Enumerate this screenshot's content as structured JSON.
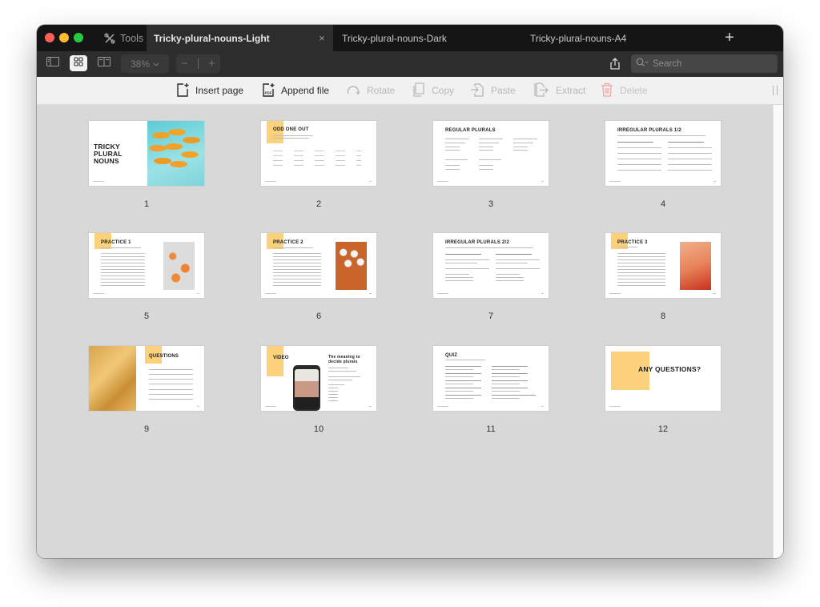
{
  "window": {
    "tools_label": "Tools",
    "tabs": [
      {
        "label": "Tricky-plural-nouns-Light",
        "active": true
      },
      {
        "label": "Tricky-plural-nouns-Dark",
        "active": false
      },
      {
        "label": "Tricky-plural-nouns-A4",
        "active": false
      }
    ],
    "close_tab_glyph": "×",
    "new_tab_glyph": "+"
  },
  "toolbar": {
    "view_modes": [
      "sidebar-view",
      "grid-view",
      "two-page-view"
    ],
    "active_view": "grid-view",
    "zoom_level": "38%",
    "zoom_out_glyph": "−",
    "zoom_in_glyph": "+",
    "search_placeholder": "Search"
  },
  "actions": [
    {
      "label": "Insert page",
      "icon": "insert-page-icon",
      "enabled": true
    },
    {
      "label": "Append file",
      "icon": "append-pdf-icon",
      "enabled": true
    },
    {
      "label": "Rotate",
      "icon": "rotate-icon",
      "enabled": false
    },
    {
      "label": "Copy",
      "icon": "copy-icon",
      "enabled": false
    },
    {
      "label": "Paste",
      "icon": "paste-icon",
      "enabled": false
    },
    {
      "label": "Extract",
      "icon": "extract-icon",
      "enabled": false
    },
    {
      "label": "Delete",
      "icon": "trash-icon",
      "enabled": false
    }
  ],
  "colors": {
    "accent_yellow": "#fbd27b",
    "delete_red": "#f2a3a3"
  },
  "pages": [
    {
      "number": "1",
      "title": "TRICKY PLURAL NOUNS"
    },
    {
      "number": "2",
      "title": "ODD ONE OUT"
    },
    {
      "number": "3",
      "title": "REGULAR PLURALS"
    },
    {
      "number": "4",
      "title": "IRREGULAR PLURALS 1/2"
    },
    {
      "number": "5",
      "title": "PRACTICE 1"
    },
    {
      "number": "6",
      "title": "PRACTICE 2"
    },
    {
      "number": "7",
      "title": "IRREGULAR PLURALS 2/2"
    },
    {
      "number": "8",
      "title": "PRACTICE 3"
    },
    {
      "number": "9",
      "title": "QUESTIONS"
    },
    {
      "number": "10",
      "title": "VIDEO",
      "subtitle": "The meaning to decide plurals"
    },
    {
      "number": "11",
      "title": "QUIZ"
    },
    {
      "number": "12",
      "title": "ANY QUESTIONS?"
    }
  ]
}
